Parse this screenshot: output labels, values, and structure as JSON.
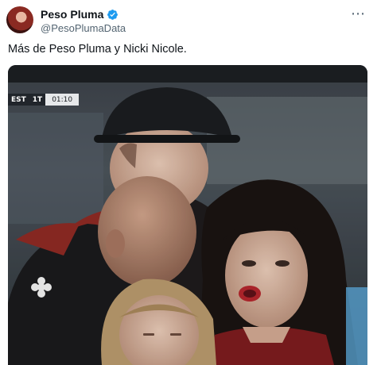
{
  "author": {
    "display_name": "Peso Pluma",
    "handle": "@PesoPlumaData",
    "verified_color": "#1d9bf0"
  },
  "more_icon": "more-horizontal-icon",
  "tweet": {
    "text": "Más de Peso Pluma y Nicki Nicole."
  },
  "media": {
    "scorebug": {
      "team": "EST",
      "period": "1T",
      "time": "01:10"
    }
  }
}
